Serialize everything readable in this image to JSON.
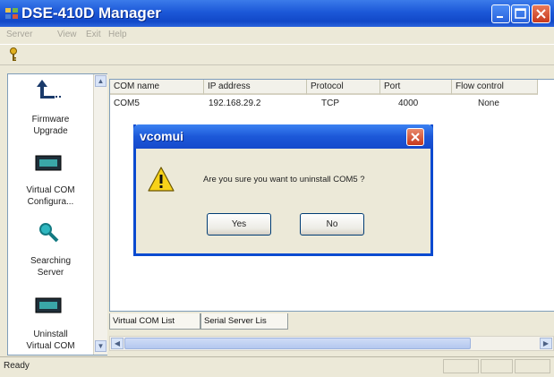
{
  "window": {
    "title": "DSE-410D Manager"
  },
  "menu": [
    "Server",
    "View",
    "Exit",
    "Help"
  ],
  "toolbar": {
    "icon": "key-icon"
  },
  "sidebar": {
    "items": [
      {
        "icon": "upload-arrow-icon",
        "label1": "Firmware",
        "label2": "Upgrade"
      },
      {
        "icon": "serial-port-icon",
        "label1": "Virtual COM",
        "label2": "Configura..."
      },
      {
        "icon": "magnifier-key-icon",
        "label1": "Searching",
        "label2": "Server"
      },
      {
        "icon": "serial-port-icon",
        "label1": "Uninstall",
        "label2": "Virtual COM"
      }
    ]
  },
  "list": {
    "columns": [
      "COM name",
      "IP address",
      "Protocol",
      "Port",
      "Flow control"
    ],
    "rows": [
      [
        "COM5",
        "192.168.29.2",
        "TCP",
        "4000",
        "None"
      ]
    ]
  },
  "tabs": [
    "Virtual COM List",
    "Serial Server Lis"
  ],
  "status": {
    "text": "Ready"
  },
  "dialog": {
    "title": "vcomui",
    "message": "Are you sure you want to uninstall COM5 ?",
    "yes_label": "Yes",
    "no_label": "No",
    "icon": "warning-icon"
  },
  "colors": {
    "title_blue": "#1c58d8",
    "window_bg": "#ece9d8",
    "close_red": "#c7391d"
  }
}
